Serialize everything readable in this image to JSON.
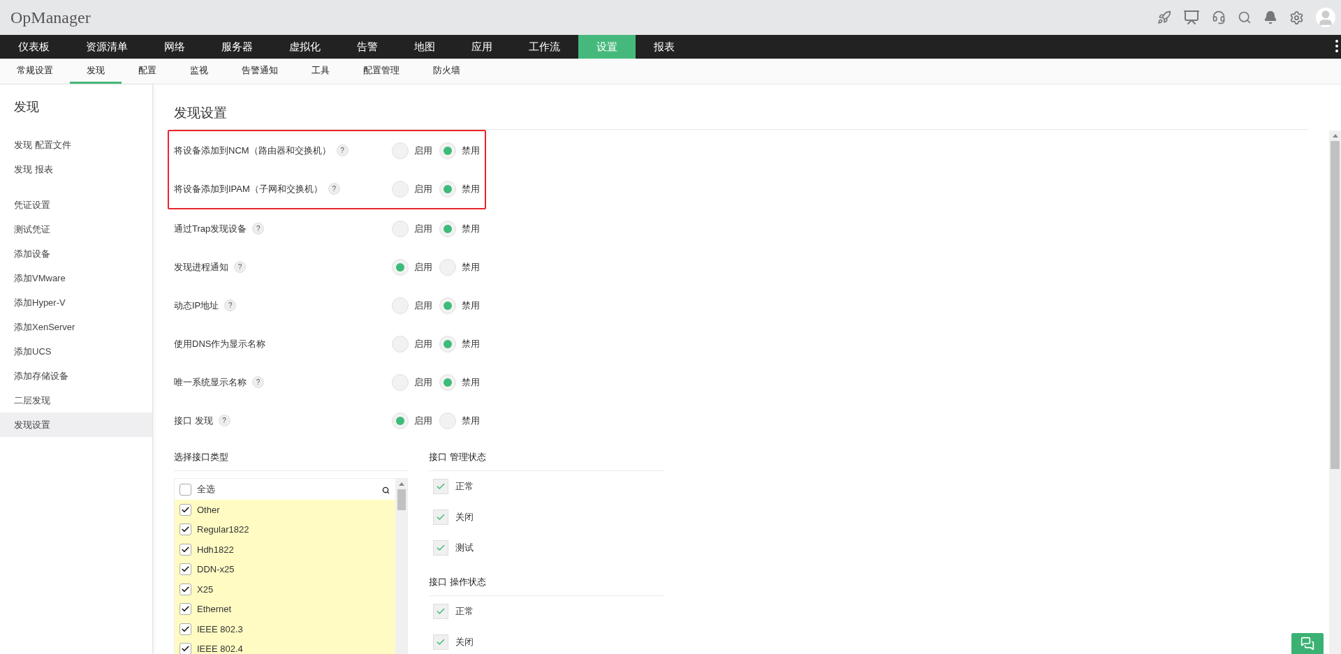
{
  "app": {
    "title": "OpManager"
  },
  "main_nav": [
    {
      "label": "仪表板",
      "selected": false
    },
    {
      "label": "资源清单",
      "selected": false
    },
    {
      "label": "网络",
      "selected": false
    },
    {
      "label": "服务器",
      "selected": false
    },
    {
      "label": "虚拟化",
      "selected": false
    },
    {
      "label": "告警",
      "selected": false
    },
    {
      "label": "地图",
      "selected": false
    },
    {
      "label": "应用",
      "selected": false
    },
    {
      "label": "工作流",
      "selected": false
    },
    {
      "label": "设置",
      "selected": true
    },
    {
      "label": "报表",
      "selected": false
    }
  ],
  "sub_nav": [
    {
      "label": "常规设置",
      "selected": false
    },
    {
      "label": "发现",
      "selected": true
    },
    {
      "label": "配置",
      "selected": false
    },
    {
      "label": "监视",
      "selected": false
    },
    {
      "label": "告警通知",
      "selected": false
    },
    {
      "label": "工具",
      "selected": false
    },
    {
      "label": "配置管理",
      "selected": false
    },
    {
      "label": "防火墙",
      "selected": false
    }
  ],
  "sidebar": {
    "title": "发现",
    "groups": [
      [
        {
          "label": "发现 配置文件",
          "selected": false
        },
        {
          "label": "发现 报表",
          "selected": false
        }
      ],
      [
        {
          "label": "凭证设置",
          "selected": false
        },
        {
          "label": "测试凭证",
          "selected": false
        },
        {
          "label": "添加设备",
          "selected": false
        },
        {
          "label": "添加VMware",
          "selected": false
        },
        {
          "label": "添加Hyper-V",
          "selected": false
        },
        {
          "label": "添加XenServer",
          "selected": false
        },
        {
          "label": "添加UCS",
          "selected": false
        },
        {
          "label": "添加存储设备",
          "selected": false
        },
        {
          "label": "二层发现",
          "selected": false
        },
        {
          "label": "发现设置",
          "selected": true
        }
      ]
    ]
  },
  "page": {
    "title": "发现设置",
    "framed_settings": [
      {
        "label": "将设备添加到NCM（路由器和交换机）",
        "help": "?",
        "options": [
          {
            "label": "启用",
            "selected": false
          },
          {
            "label": "禁用",
            "selected": true
          }
        ]
      },
      {
        "label": "将设备添加到IPAM（子网和交换机）",
        "help": "?",
        "options": [
          {
            "label": "启用",
            "selected": false
          },
          {
            "label": "禁用",
            "selected": true
          }
        ]
      }
    ],
    "settings": [
      {
        "label": "通过Trap发现设备",
        "help": "?",
        "options": [
          {
            "label": "启用",
            "selected": false
          },
          {
            "label": "禁用",
            "selected": true
          }
        ]
      },
      {
        "label": "发现进程通知",
        "help": "?",
        "options": [
          {
            "label": "启用",
            "selected": true
          },
          {
            "label": "禁用",
            "selected": false
          }
        ]
      },
      {
        "label": "动态IP地址",
        "help": "?",
        "options": [
          {
            "label": "启用",
            "selected": false
          },
          {
            "label": "禁用",
            "selected": true
          }
        ]
      },
      {
        "label": "使用DNS作为显示名称",
        "options": [
          {
            "label": "启用",
            "selected": false
          },
          {
            "label": "禁用",
            "selected": true
          }
        ]
      },
      {
        "label": "唯一系统显示名称",
        "help": "?",
        "options": [
          {
            "label": "启用",
            "selected": false
          },
          {
            "label": "禁用",
            "selected": true
          }
        ]
      },
      {
        "label": "接口 发现",
        "help": "?",
        "options": [
          {
            "label": "启用",
            "selected": true
          },
          {
            "label": "禁用",
            "selected": false
          }
        ]
      }
    ],
    "interface_types": {
      "title": "选择接口类型",
      "select_all": {
        "label": "全选",
        "checked": false
      },
      "items": [
        {
          "label": "Other",
          "checked": true
        },
        {
          "label": "Regular1822",
          "checked": true
        },
        {
          "label": "Hdh1822",
          "checked": true
        },
        {
          "label": "DDN-x25",
          "checked": true
        },
        {
          "label": "X25",
          "checked": true
        },
        {
          "label": "Ethernet",
          "checked": true
        },
        {
          "label": "IEEE 802.3",
          "checked": true
        },
        {
          "label": "IEEE 802.4",
          "checked": true
        }
      ]
    },
    "status_groups": [
      {
        "title": "接口 管理状态",
        "items": [
          {
            "label": "正常",
            "checked": true
          },
          {
            "label": "关闭",
            "checked": true
          },
          {
            "label": "测试",
            "checked": true
          }
        ]
      },
      {
        "title": "接口 操作状态",
        "items": [
          {
            "label": "正常",
            "checked": true
          },
          {
            "label": "关闭",
            "checked": true
          }
        ]
      }
    ]
  }
}
